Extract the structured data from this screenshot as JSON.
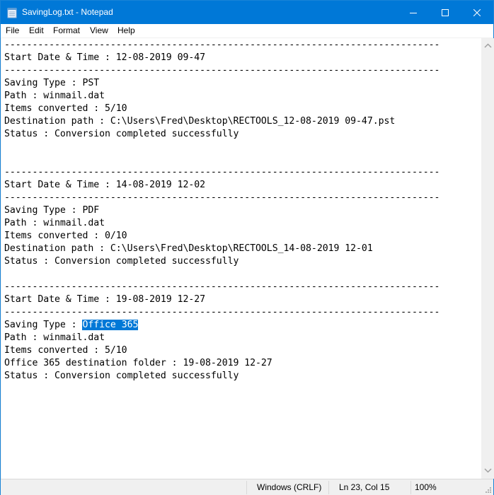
{
  "window": {
    "title": "SavingLog.txt - Notepad",
    "accent_color": "#0078d7",
    "controls": [
      "minimize-icon",
      "maximize-icon",
      "close-icon"
    ]
  },
  "menu": {
    "items": [
      "File",
      "Edit",
      "Format",
      "View",
      "Help"
    ]
  },
  "document": {
    "lines": [
      "------------------------------------------------------------------------------",
      "Start Date & Time : 12-08-2019 09-47",
      "------------------------------------------------------------------------------",
      "Saving Type : PST",
      "Path : winmail.dat",
      "Items converted : 5/10",
      "Destination path : C:\\Users\\Fred\\Desktop\\RECTOOLS_12-08-2019 09-47.pst",
      "Status : Conversion completed successfully",
      "",
      "",
      "------------------------------------------------------------------------------",
      "Start Date & Time : 14-08-2019 12-02",
      "------------------------------------------------------------------------------",
      "Saving Type : PDF",
      "Path : winmail.dat",
      "Items converted : 0/10",
      "Destination path : C:\\Users\\Fred\\Desktop\\RECTOOLS_14-08-2019 12-01",
      "Status : Conversion completed successfully",
      "",
      "------------------------------------------------------------------------------",
      "Start Date & Time : 19-08-2019 12-27",
      "------------------------------------------------------------------------------",
      "Saving Type : Office 365",
      "Path : winmail.dat",
      "Items converted : 5/10",
      "Office 365 destination folder : 19-08-2019 12-27",
      "Status : Conversion completed successfully"
    ],
    "selection": {
      "line": 23,
      "prefix": "Saving Type : ",
      "selected_text": "Office 365"
    },
    "selection_color": "#0078d7"
  },
  "status_bar": {
    "line_ending": "Windows (CRLF)",
    "position": "Ln 23, Col 15",
    "zoom": "100%"
  }
}
